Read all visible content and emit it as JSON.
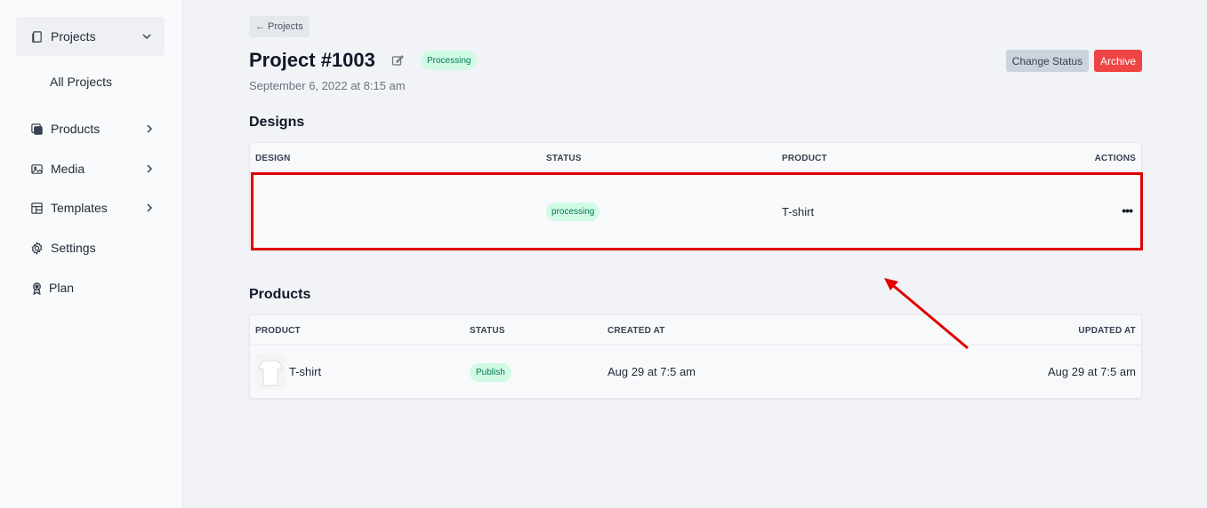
{
  "sidebar": {
    "projects_label": "Projects",
    "sub_all_projects": "All Projects",
    "items": [
      {
        "label": "Products",
        "icon": "products-icon"
      },
      {
        "label": "Media",
        "icon": "media-icon"
      },
      {
        "label": "Templates",
        "icon": "templates-icon"
      },
      {
        "label": "Settings",
        "icon": "gear-icon"
      },
      {
        "label": "Plan",
        "icon": "award-icon"
      }
    ]
  },
  "header": {
    "back_label": "Projects",
    "title": "Project #1003",
    "status": "Processing",
    "date": "September 6, 2022 at 8:15 am",
    "change_status_label": "Change Status",
    "archive_label": "Archive"
  },
  "designs": {
    "heading": "Designs",
    "columns": [
      "DESIGN",
      "STATUS",
      "PRODUCT",
      "ACTIONS"
    ],
    "rows": [
      {
        "design": "",
        "status": "processing",
        "product": "T-shirt",
        "actions": "•••"
      }
    ]
  },
  "products": {
    "heading": "Products",
    "columns": [
      "PRODUCT",
      "STATUS",
      "CREATED AT",
      "UPDATED AT"
    ],
    "rows": [
      {
        "product": "T-shirt",
        "status": "Publish",
        "created_at": "Aug 29 at 7:5 am",
        "updated_at": "Aug 29 at 7:5 am"
      }
    ]
  },
  "colors": {
    "accent_red": "#ef4444",
    "status_green_bg": "#d1fae5",
    "status_green_text": "#047857",
    "annotation_red": "#e00000"
  }
}
